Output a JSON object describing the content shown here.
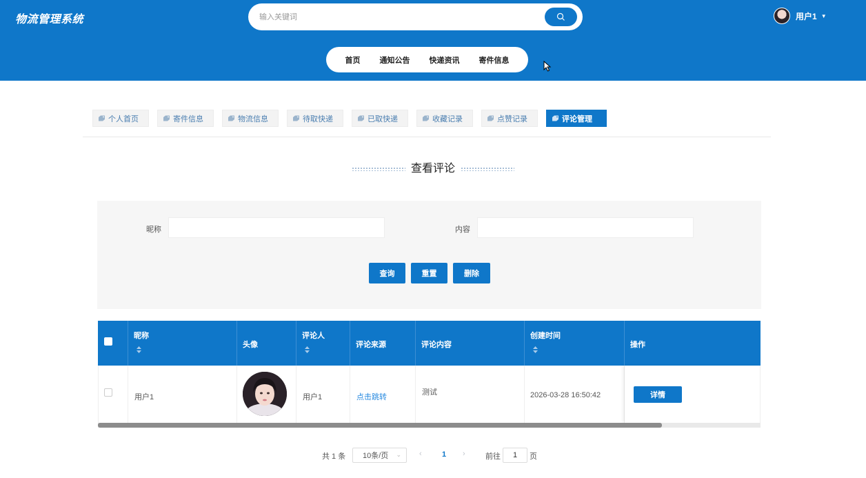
{
  "header": {
    "logo": "物流管理系统",
    "search_placeholder": "输入关键词",
    "user_name": "用户1"
  },
  "nav": {
    "items": [
      "首页",
      "通知公告",
      "快递资讯",
      "寄件信息"
    ]
  },
  "tabs": {
    "items": [
      "个人首页",
      "寄件信息",
      "物流信息",
      "待取快递",
      "已取快递",
      "收藏记录",
      "点赞记录",
      "评论管理"
    ],
    "active": "评论管理"
  },
  "section": {
    "title": "查看评论"
  },
  "filter": {
    "nickname_label": "昵称",
    "nickname_value": "",
    "content_label": "内容",
    "content_value": "",
    "query_label": "查询",
    "reset_label": "重置",
    "delete_label": "删除"
  },
  "table": {
    "columns": [
      "昵称",
      "头像",
      "评论人",
      "评论来源",
      "评论内容",
      "创建时间",
      "操作"
    ],
    "rows": [
      {
        "nickname": "用户1",
        "commenter": "用户1",
        "source": "点击跳转",
        "content": "测试",
        "created": "2026-03-28 16:50:42",
        "action": "详情"
      }
    ]
  },
  "pagination": {
    "total": "共 1 条",
    "page_size": "10条/页",
    "current_page": "1",
    "goto_label": "前往",
    "goto_value": "1",
    "page_suffix": "页"
  },
  "colors": {
    "primary": "#0f77c9",
    "link": "#2a8be0"
  }
}
